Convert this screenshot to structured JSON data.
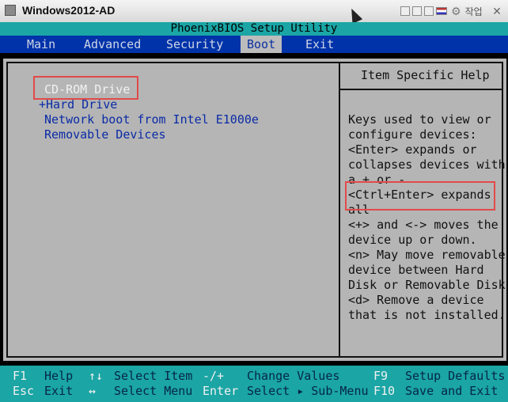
{
  "window": {
    "title": "Windows2012-AD",
    "toolbar_label": "작업"
  },
  "bios": {
    "header": "PhoenixBIOS Setup Utility",
    "menu": [
      "Main",
      "Advanced",
      "Security",
      "Boot",
      "Exit"
    ],
    "active_menu": "Boot",
    "boot_items": [
      "CD-ROM Drive",
      "+Hard Drive",
      "Network boot from Intel E1000e",
      "Removable Devices"
    ],
    "selected_boot_item": "CD-ROM Drive",
    "help_title": "Item Specific Help",
    "help_lines": [
      "Keys used to view or",
      "configure devices:",
      "<Enter> expands or",
      "collapses devices with",
      "a + or -",
      "<Ctrl+Enter> expands",
      "all",
      "<+> and <-> moves the",
      "device up or down.",
      "<n> May move removable",
      "device between Hard",
      "Disk or Removable Disk",
      "<d> Remove a device",
      "that is not installed."
    ],
    "footer": {
      "row1": {
        "k1": "F1",
        "d1": "Help",
        "k2": "↑↓",
        "d2": "Select Item",
        "k3": "-/+",
        "d3": "Change Values",
        "k4": "F9",
        "d4": "Setup Defaults"
      },
      "row2": {
        "k1": "Esc",
        "d1": "Exit",
        "k2": "↔",
        "d2": "Select Menu",
        "k3": "Enter",
        "d3": "Select ▸ Sub-Menu",
        "k4": "F10",
        "d4": "Save and Exit"
      }
    }
  },
  "colors": {
    "header_bg": "#1ba5a5",
    "menu_bg": "#0033aa",
    "panel_bg": "#b5b5b5",
    "highlight_box": "#e24a4a"
  },
  "icons": [
    "window-icon",
    "gear-icon",
    "flag-icon",
    "close-icon",
    "mouse-cursor-icon"
  ]
}
